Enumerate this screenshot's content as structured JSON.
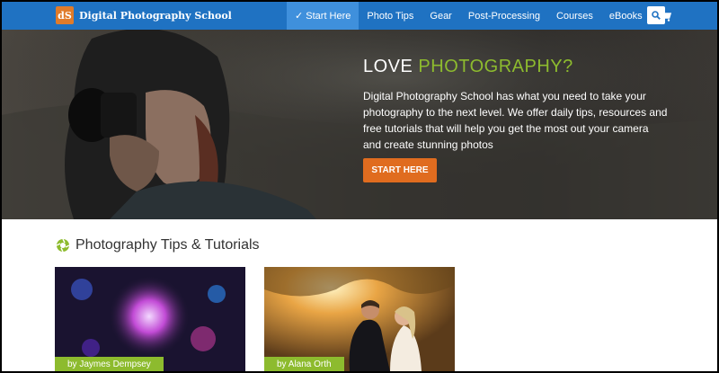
{
  "site": {
    "logo_initials": "dS",
    "name": "Digital Photography School"
  },
  "nav": {
    "items": [
      {
        "label": "✓ Start Here",
        "active": true
      },
      {
        "label": "Photo Tips",
        "active": false
      },
      {
        "label": "Gear",
        "active": false
      },
      {
        "label": "Post-Processing",
        "active": false
      },
      {
        "label": "Courses",
        "active": false
      },
      {
        "label": "eBooks",
        "active": false
      }
    ],
    "icons": [
      "cart-icon",
      "search-icon"
    ]
  },
  "hero": {
    "title_plain": "LOVE ",
    "title_accent": "PHOTOGRAPHY?",
    "description": "Digital Photography School has what you need to take your photography to the next level. We offer daily tips, resources and free tutorials that will help you get the most out your camera and create stunning photos",
    "cta_label": "START HERE"
  },
  "section": {
    "title": "Photography Tips & Tutorials"
  },
  "cards": [
    {
      "byline": "by Jaymes Dempsey"
    },
    {
      "byline": "by Alana Orth"
    }
  ],
  "colors": {
    "nav_bg": "#1f72c2",
    "nav_active": "#3f90dc",
    "accent_green": "#8dbb2e",
    "cta_orange": "#e06c1f",
    "logo_orange": "#e07b2a"
  }
}
